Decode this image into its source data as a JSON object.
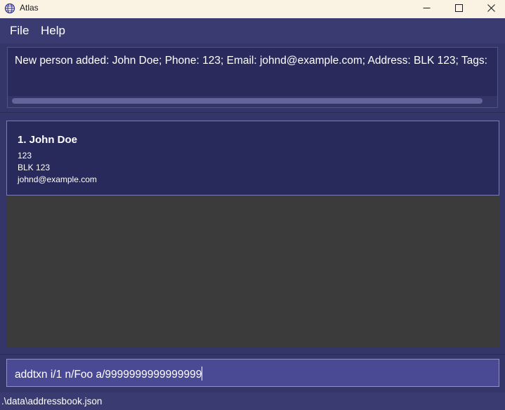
{
  "window": {
    "title": "Atlas",
    "icon": "globe-icon"
  },
  "menu": {
    "file_label": "File",
    "help_label": "Help"
  },
  "result": {
    "text": "New person added: John Doe; Phone: 123; Email: johnd@example.com; Address: BLK 123; Tags: "
  },
  "person_list": {
    "persons": [
      {
        "index_name": "1. John Doe",
        "phone": "123",
        "address": "BLK 123",
        "email": "johnd@example.com"
      }
    ]
  },
  "command": {
    "value": "addtxn i/1 n/Foo a/9999999999999999"
  },
  "status": {
    "file_path": ".\\data\\addressbook.json"
  },
  "colors": {
    "titlebar_bg": "#faf3e4",
    "app_bg": "#383a6c",
    "card_bg": "#282a5b",
    "list_empty_bg": "#3b3b3b",
    "command_bg": "#4a4a94"
  }
}
